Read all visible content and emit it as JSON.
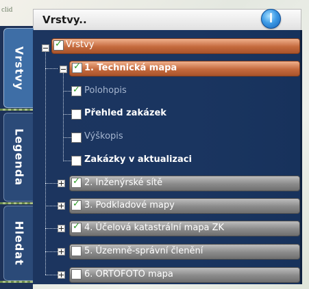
{
  "map": {
    "corner_label": "clid"
  },
  "header": {
    "title": "Vrstvy..",
    "button_icon": "info-icon"
  },
  "tabs": [
    {
      "label": "Vrstvy",
      "active": true
    },
    {
      "label": "Legenda",
      "active": false
    },
    {
      "label": "Hledat",
      "active": false
    }
  ],
  "tree": {
    "root": {
      "label": "Vrstvy",
      "checked": true,
      "expanded": true
    },
    "groups": [
      {
        "label": "1. Technická mapa",
        "checked": true,
        "expanded": true,
        "highlight": "orange",
        "children": [
          {
            "label": "Polohopis",
            "checked": true,
            "enabled": false
          },
          {
            "label": "Přehled zakázek",
            "checked": false,
            "enabled": true
          },
          {
            "label": "Výškopis",
            "checked": false,
            "enabled": false
          },
          {
            "label": "Zakázky v aktualizaci",
            "checked": false,
            "enabled": true
          }
        ]
      },
      {
        "label": "2. Inženýrské sítě",
        "checked": true,
        "expanded": false
      },
      {
        "label": "3. Podkladové mapy",
        "checked": true,
        "expanded": false
      },
      {
        "label": "4. Účelová katastrální mapa ZK",
        "checked": true,
        "expanded": false
      },
      {
        "label": "5. Územně-správní členění",
        "checked": false,
        "expanded": false
      },
      {
        "label": "6. ORTOFOTO mapa",
        "checked": false,
        "expanded": false
      }
    ]
  },
  "colors": {
    "panel": "#1c355f",
    "accent_orange": "#c46a3d",
    "gray_pill": "#8a8a8a",
    "check": "#2a9a23"
  }
}
